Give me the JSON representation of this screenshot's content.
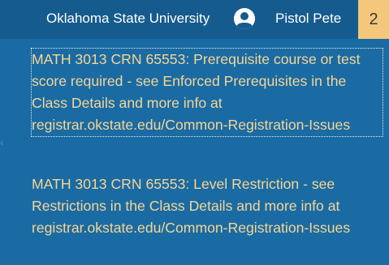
{
  "header": {
    "institution": "Oklahoma State University",
    "user_name": "Pistol Pete",
    "notification_count": "2"
  },
  "messages": [
    {
      "text": "MATH 3013 CRN 65553: Prerequisite course or test score required - see Enforced Prerequisites in the Class Details and more info at registrar.okstate.edu/Common-Registration-Issues",
      "focused": true
    },
    {
      "text": "MATH 3013 CRN 65553: Level Restriction - see Restrictions in the Class Details and more info at registrar.okstate.edu/Common-Registration-Issues",
      "focused": false
    }
  ],
  "colors": {
    "header_bg": "#165b8e",
    "panel_bg": "#1a6ba3",
    "message_text": "#f6d596",
    "badge_bg": "#f4c77c"
  },
  "icons": {
    "avatar": "user-avatar-icon",
    "edge": "chevron-left-icon"
  }
}
